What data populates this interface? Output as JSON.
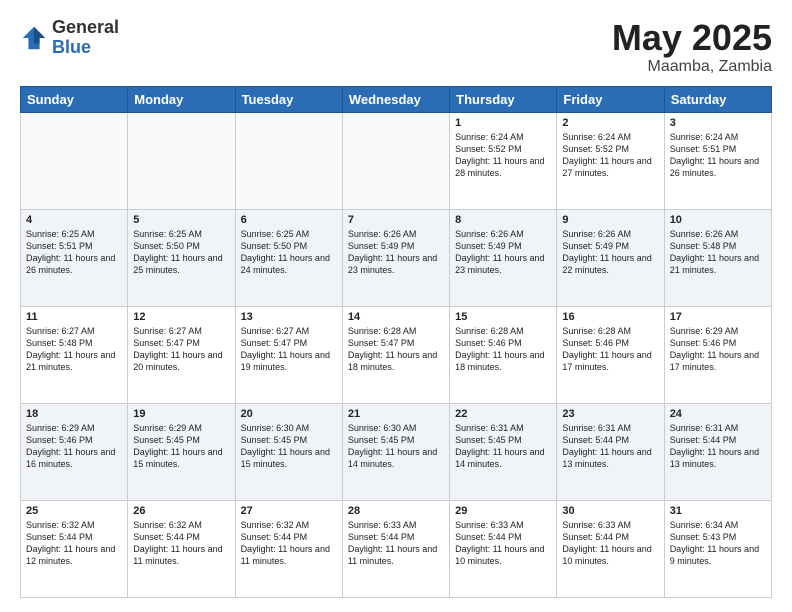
{
  "logo": {
    "general": "General",
    "blue": "Blue"
  },
  "title": {
    "month": "May 2025",
    "location": "Maamba, Zambia"
  },
  "days_of_week": [
    "Sunday",
    "Monday",
    "Tuesday",
    "Wednesday",
    "Thursday",
    "Friday",
    "Saturday"
  ],
  "weeks": [
    [
      {
        "day": "",
        "content": ""
      },
      {
        "day": "",
        "content": ""
      },
      {
        "day": "",
        "content": ""
      },
      {
        "day": "",
        "content": ""
      },
      {
        "day": "1",
        "content": "Sunrise: 6:24 AM\nSunset: 5:52 PM\nDaylight: 11 hours and 28 minutes."
      },
      {
        "day": "2",
        "content": "Sunrise: 6:24 AM\nSunset: 5:52 PM\nDaylight: 11 hours and 27 minutes."
      },
      {
        "day": "3",
        "content": "Sunrise: 6:24 AM\nSunset: 5:51 PM\nDaylight: 11 hours and 26 minutes."
      }
    ],
    [
      {
        "day": "4",
        "content": "Sunrise: 6:25 AM\nSunset: 5:51 PM\nDaylight: 11 hours and 26 minutes."
      },
      {
        "day": "5",
        "content": "Sunrise: 6:25 AM\nSunset: 5:50 PM\nDaylight: 11 hours and 25 minutes."
      },
      {
        "day": "6",
        "content": "Sunrise: 6:25 AM\nSunset: 5:50 PM\nDaylight: 11 hours and 24 minutes."
      },
      {
        "day": "7",
        "content": "Sunrise: 6:26 AM\nSunset: 5:49 PM\nDaylight: 11 hours and 23 minutes."
      },
      {
        "day": "8",
        "content": "Sunrise: 6:26 AM\nSunset: 5:49 PM\nDaylight: 11 hours and 23 minutes."
      },
      {
        "day": "9",
        "content": "Sunrise: 6:26 AM\nSunset: 5:49 PM\nDaylight: 11 hours and 22 minutes."
      },
      {
        "day": "10",
        "content": "Sunrise: 6:26 AM\nSunset: 5:48 PM\nDaylight: 11 hours and 21 minutes."
      }
    ],
    [
      {
        "day": "11",
        "content": "Sunrise: 6:27 AM\nSunset: 5:48 PM\nDaylight: 11 hours and 21 minutes."
      },
      {
        "day": "12",
        "content": "Sunrise: 6:27 AM\nSunset: 5:47 PM\nDaylight: 11 hours and 20 minutes."
      },
      {
        "day": "13",
        "content": "Sunrise: 6:27 AM\nSunset: 5:47 PM\nDaylight: 11 hours and 19 minutes."
      },
      {
        "day": "14",
        "content": "Sunrise: 6:28 AM\nSunset: 5:47 PM\nDaylight: 11 hours and 18 minutes."
      },
      {
        "day": "15",
        "content": "Sunrise: 6:28 AM\nSunset: 5:46 PM\nDaylight: 11 hours and 18 minutes."
      },
      {
        "day": "16",
        "content": "Sunrise: 6:28 AM\nSunset: 5:46 PM\nDaylight: 11 hours and 17 minutes."
      },
      {
        "day": "17",
        "content": "Sunrise: 6:29 AM\nSunset: 5:46 PM\nDaylight: 11 hours and 17 minutes."
      }
    ],
    [
      {
        "day": "18",
        "content": "Sunrise: 6:29 AM\nSunset: 5:46 PM\nDaylight: 11 hours and 16 minutes."
      },
      {
        "day": "19",
        "content": "Sunrise: 6:29 AM\nSunset: 5:45 PM\nDaylight: 11 hours and 15 minutes."
      },
      {
        "day": "20",
        "content": "Sunrise: 6:30 AM\nSunset: 5:45 PM\nDaylight: 11 hours and 15 minutes."
      },
      {
        "day": "21",
        "content": "Sunrise: 6:30 AM\nSunset: 5:45 PM\nDaylight: 11 hours and 14 minutes."
      },
      {
        "day": "22",
        "content": "Sunrise: 6:31 AM\nSunset: 5:45 PM\nDaylight: 11 hours and 14 minutes."
      },
      {
        "day": "23",
        "content": "Sunrise: 6:31 AM\nSunset: 5:44 PM\nDaylight: 11 hours and 13 minutes."
      },
      {
        "day": "24",
        "content": "Sunrise: 6:31 AM\nSunset: 5:44 PM\nDaylight: 11 hours and 13 minutes."
      }
    ],
    [
      {
        "day": "25",
        "content": "Sunrise: 6:32 AM\nSunset: 5:44 PM\nDaylight: 11 hours and 12 minutes."
      },
      {
        "day": "26",
        "content": "Sunrise: 6:32 AM\nSunset: 5:44 PM\nDaylight: 11 hours and 11 minutes."
      },
      {
        "day": "27",
        "content": "Sunrise: 6:32 AM\nSunset: 5:44 PM\nDaylight: 11 hours and 11 minutes."
      },
      {
        "day": "28",
        "content": "Sunrise: 6:33 AM\nSunset: 5:44 PM\nDaylight: 11 hours and 11 minutes."
      },
      {
        "day": "29",
        "content": "Sunrise: 6:33 AM\nSunset: 5:44 PM\nDaylight: 11 hours and 10 minutes."
      },
      {
        "day": "30",
        "content": "Sunrise: 6:33 AM\nSunset: 5:44 PM\nDaylight: 11 hours and 10 minutes."
      },
      {
        "day": "31",
        "content": "Sunrise: 6:34 AM\nSunset: 5:43 PM\nDaylight: 11 hours and 9 minutes."
      }
    ]
  ]
}
